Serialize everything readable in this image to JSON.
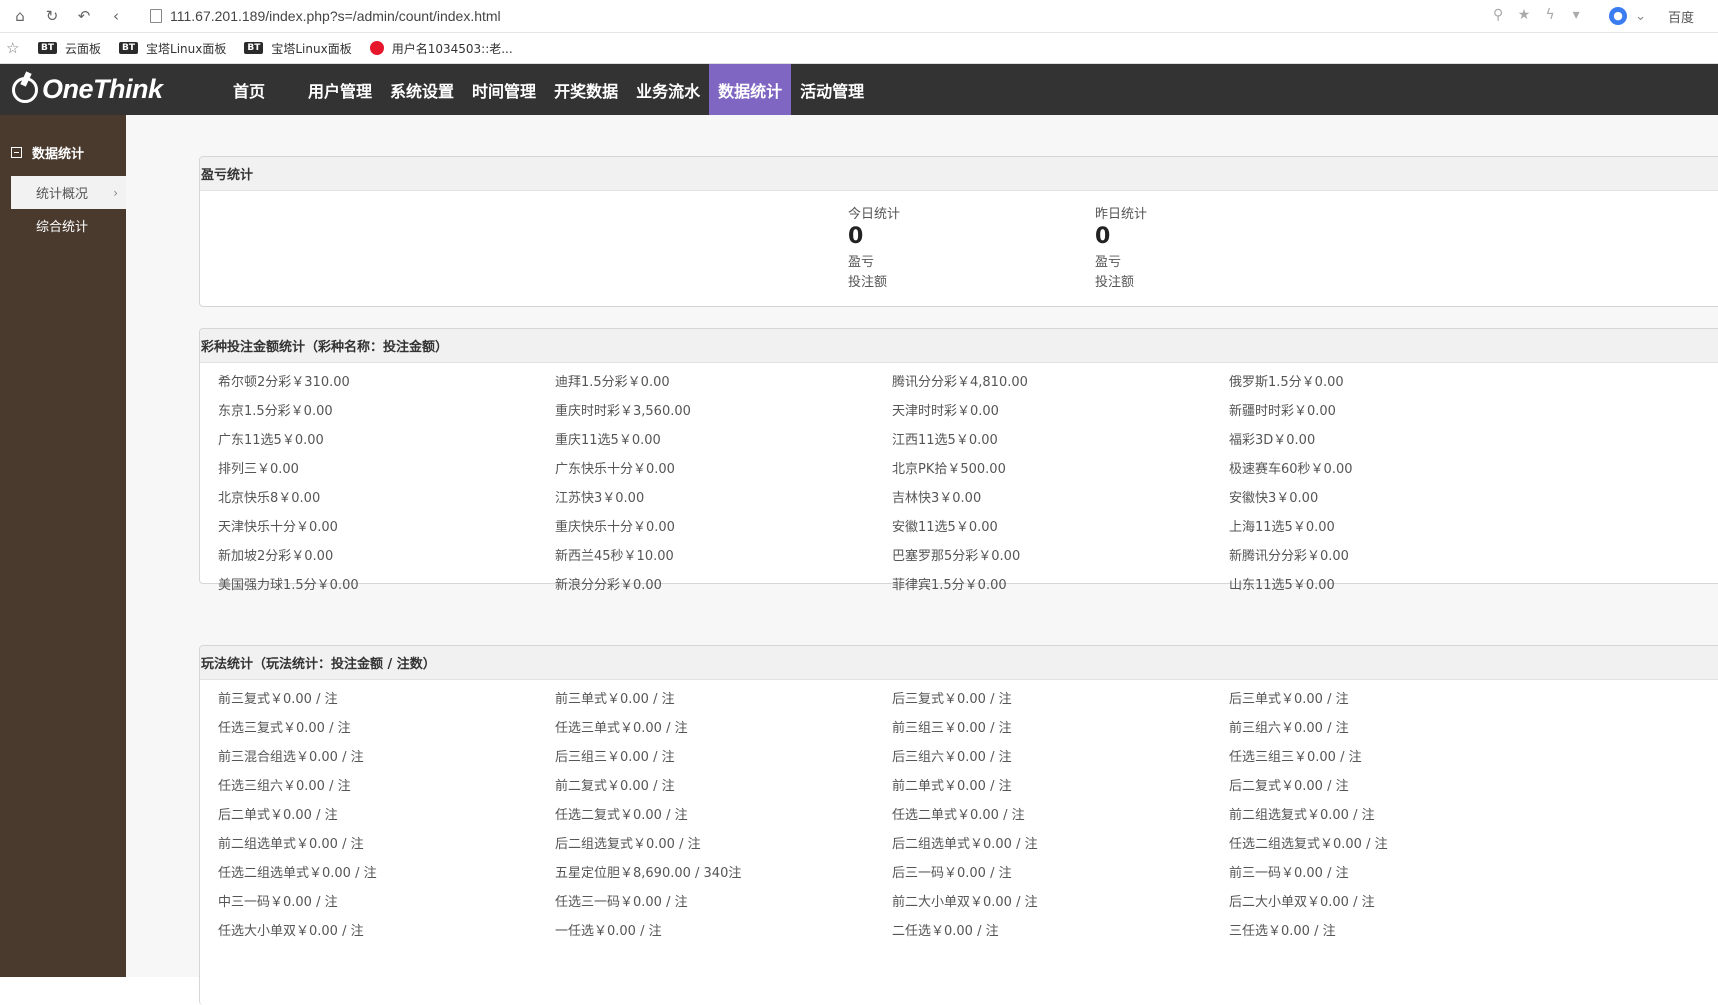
{
  "browser": {
    "url": "111.67.201.189/index.php?s=/admin/count/index.html",
    "search_engine": "百度",
    "bookmarks": [
      {
        "badge": "BT",
        "label": "云面板"
      },
      {
        "badge": "BT",
        "label": "宝塔Linux面板"
      },
      {
        "badge": "BT",
        "label": "宝塔Linux面板"
      },
      {
        "badge": "",
        "label": "用户名1034503::老..."
      }
    ]
  },
  "app": {
    "logo_text": "OneThink",
    "nav": [
      "首页",
      "用户管理",
      "系统设置",
      "时间管理",
      "开奖数据",
      "业务流水",
      "数据统计",
      "活动管理"
    ],
    "active_nav_index": 6
  },
  "sidebar": {
    "section_title": "数据统计",
    "items": [
      {
        "label": "统计概况",
        "active": true
      },
      {
        "label": "综合统计",
        "active": false
      }
    ]
  },
  "profit_panel": {
    "title": "盈亏统计",
    "today": {
      "label": "今日统计",
      "value": "0",
      "line1": "盈亏",
      "line2": "投注额"
    },
    "yesterday": {
      "label": "昨日统计",
      "value": "0",
      "line1": "盈亏",
      "line2": "投注额"
    }
  },
  "lottery_panel": {
    "title": "彩种投注金额统计（彩种名称：投注金额）",
    "rows": [
      [
        "希尔顿2分彩￥310.00",
        "迪拜1.5分彩￥0.00",
        "腾讯分分彩￥4,810.00",
        "俄罗斯1.5分￥0.00"
      ],
      [
        "东京1.5分彩￥0.00",
        "重庆时时彩￥3,560.00",
        "天津时时彩￥0.00",
        "新疆时时彩￥0.00"
      ],
      [
        "广东11选5￥0.00",
        "重庆11选5￥0.00",
        "江西11选5￥0.00",
        "福彩3D￥0.00"
      ],
      [
        "排列三￥0.00",
        "广东快乐十分￥0.00",
        "北京PK拾￥500.00",
        "极速赛车60秒￥0.00"
      ],
      [
        "北京快乐8￥0.00",
        "江苏快3￥0.00",
        "吉林快3￥0.00",
        "安徽快3￥0.00"
      ],
      [
        "天津快乐十分￥0.00",
        "重庆快乐十分￥0.00",
        "安徽11选5￥0.00",
        "上海11选5￥0.00"
      ],
      [
        "新加坡2分彩￥0.00",
        "新西兰45秒￥10.00",
        "巴塞罗那5分彩￥0.00",
        "新腾讯分分彩￥0.00"
      ],
      [
        "美国强力球1.5分￥0.00",
        "新浪分分彩￥0.00",
        "菲律宾1.5分￥0.00",
        "山东11选5￥0.00"
      ]
    ]
  },
  "play_panel": {
    "title": "玩法统计（玩法统计：投注金额 / 注数）",
    "rows": [
      [
        "前三复式￥0.00 / 注",
        "前三单式￥0.00 / 注",
        "后三复式￥0.00 / 注",
        "后三单式￥0.00 / 注"
      ],
      [
        "任选三复式￥0.00 / 注",
        "任选三单式￥0.00 / 注",
        "前三组三￥0.00 / 注",
        "前三组六￥0.00 / 注"
      ],
      [
        "前三混合组选￥0.00 / 注",
        "后三组三￥0.00 / 注",
        "后三组六￥0.00 / 注",
        "任选三组三￥0.00 / 注"
      ],
      [
        "任选三组六￥0.00 / 注",
        "前二复式￥0.00 / 注",
        "前二单式￥0.00 / 注",
        "后二复式￥0.00 / 注"
      ],
      [
        "后二单式￥0.00 / 注",
        "任选二复式￥0.00 / 注",
        "任选二单式￥0.00 / 注",
        "前二组选复式￥0.00 / 注"
      ],
      [
        "前二组选单式￥0.00 / 注",
        "后二组选复式￥0.00 / 注",
        "后二组选单式￥0.00 / 注",
        "任选二组选复式￥0.00 / 注"
      ],
      [
        "任选二组选单式￥0.00 / 注",
        "五星定位胆￥8,690.00 / 340注",
        "后三一码￥0.00 / 注",
        "前三一码￥0.00 / 注"
      ],
      [
        "中三一码￥0.00 / 注",
        "任选三一码￥0.00 / 注",
        "前二大小单双￥0.00 / 注",
        "后二大小单双￥0.00 / 注"
      ],
      [
        "任选大小单双￥0.00 / 注",
        "一任选￥0.00 / 注",
        "二任选￥0.00 / 注",
        "三任选￥0.00 / 注"
      ]
    ]
  }
}
